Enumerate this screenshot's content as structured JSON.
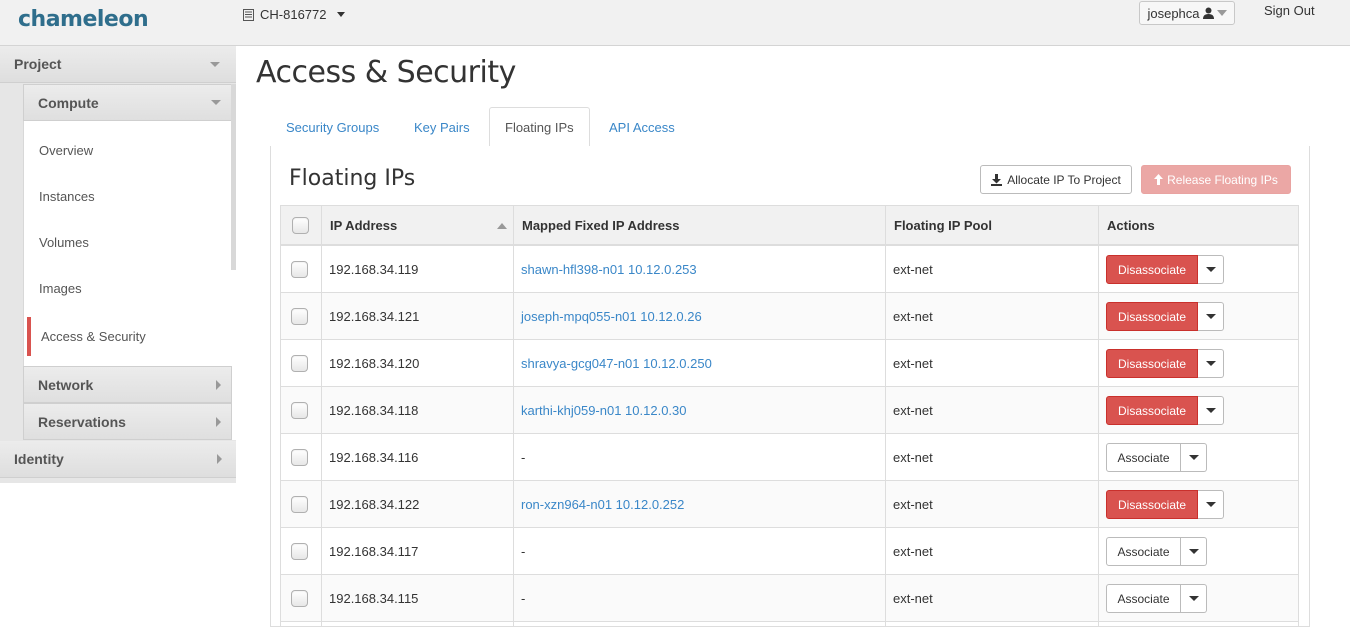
{
  "header": {
    "logo": "chameleon",
    "project": "CH-816772",
    "user": "josephca",
    "signout": "Sign Out"
  },
  "sidebar": {
    "project": "Project",
    "compute": "Compute",
    "items": [
      "Overview",
      "Instances",
      "Volumes",
      "Images"
    ],
    "active_item": "Access & Security",
    "network": "Network",
    "reservations": "Reservations",
    "identity": "Identity"
  },
  "page": {
    "title": "Access & Security",
    "tabs": [
      "Security Groups",
      "Key Pairs",
      "Floating IPs",
      "API Access"
    ],
    "active_tab": "Floating IPs",
    "panel_title": "Floating IPs",
    "allocate_label": "Allocate IP To Project",
    "release_label": "Release Floating IPs"
  },
  "table": {
    "headers": [
      "IP Address",
      "Mapped Fixed IP Address",
      "Floating IP Pool",
      "Actions"
    ],
    "rows": [
      {
        "ip": "192.168.34.119",
        "mapped": "shawn-hfl398-n01 10.12.0.253",
        "pool": "ext-net",
        "action": "Disassociate"
      },
      {
        "ip": "192.168.34.121",
        "mapped": "joseph-mpq055-n01 10.12.0.26",
        "pool": "ext-net",
        "action": "Disassociate"
      },
      {
        "ip": "192.168.34.120",
        "mapped": "shravya-gcg047-n01 10.12.0.250",
        "pool": "ext-net",
        "action": "Disassociate"
      },
      {
        "ip": "192.168.34.118",
        "mapped": "karthi-khj059-n01 10.12.0.30",
        "pool": "ext-net",
        "action": "Disassociate"
      },
      {
        "ip": "192.168.34.116",
        "mapped": "-",
        "pool": "ext-net",
        "action": "Associate"
      },
      {
        "ip": "192.168.34.122",
        "mapped": "ron-xzn964-n01 10.12.0.252",
        "pool": "ext-net",
        "action": "Disassociate"
      },
      {
        "ip": "192.168.34.117",
        "mapped": "-",
        "pool": "ext-net",
        "action": "Associate"
      },
      {
        "ip": "192.168.34.115",
        "mapped": "-",
        "pool": "ext-net",
        "action": "Associate"
      }
    ]
  },
  "colors": {
    "danger": "#d9534f",
    "link": "#3a87c8"
  }
}
